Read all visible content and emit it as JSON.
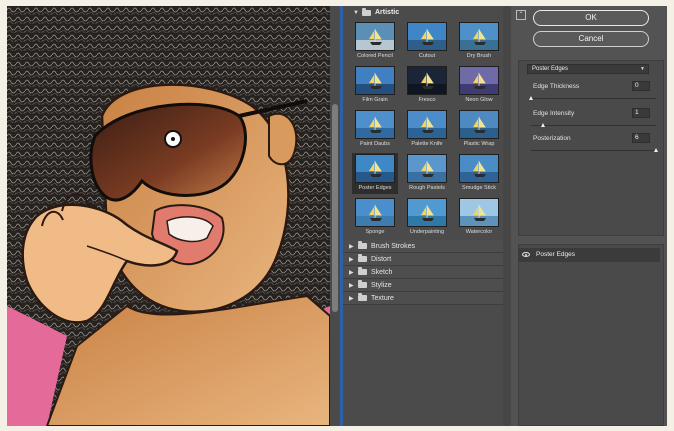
{
  "gallery": {
    "open_folder": "Artistic",
    "thumbnails": [
      {
        "label": "Colored Pencil",
        "sky": "#5b8fb6",
        "sea": "#b6c7cf"
      },
      {
        "label": "Cutout",
        "sky": "#3f86c9",
        "sea": "#2e5f8a"
      },
      {
        "label": "Dry Brush",
        "sky": "#4e90c8",
        "sea": "#3a6f96"
      },
      {
        "label": "Film Grain",
        "sky": "#3f7fc2",
        "sea": "#244f7f"
      },
      {
        "label": "Fresco",
        "sky": "#1c2538",
        "sea": "#0f1522"
      },
      {
        "label": "Neon Glow",
        "sky": "#6f6aa8",
        "sea": "#3e3c72"
      },
      {
        "label": "Paint Daubs",
        "sky": "#4f8fcb",
        "sea": "#2f6aa0"
      },
      {
        "label": "Palette Knife",
        "sky": "#4c8cc8",
        "sea": "#2c6397"
      },
      {
        "label": "Plastic Wrap",
        "sky": "#4e89bf",
        "sea": "#2b5f8e"
      },
      {
        "label": "Poster Edges",
        "sky": "#3e88c6",
        "sea": "#26598a"
      },
      {
        "label": "Rough Pastels",
        "sky": "#5b97cc",
        "sea": "#3a70a0"
      },
      {
        "label": "Smudge Stick",
        "sky": "#4a8dc6",
        "sea": "#2d6396"
      },
      {
        "label": "Sponge",
        "sky": "#4a8fcb",
        "sea": "#3e7cb0"
      },
      {
        "label": "Underpainting",
        "sky": "#4f9ad0",
        "sea": "#2f79a8"
      },
      {
        "label": "Watercolor",
        "sky": "#9ec7e6",
        "sea": "#5d92bb"
      }
    ],
    "folders": [
      "Brush Strokes",
      "Distort",
      "Sketch",
      "Stylize",
      "Texture"
    ]
  },
  "buttons": {
    "ok": "OK",
    "cancel": "Cancel"
  },
  "filter_select": "Poster Edges",
  "params": [
    {
      "label": "Edge Thickness",
      "value": "0",
      "fraction": 0.0
    },
    {
      "label": "Edge Intensity",
      "value": "1",
      "fraction": 0.1
    },
    {
      "label": "Posterization",
      "value": "6",
      "fraction": 1.0
    }
  ],
  "layer": {
    "name": "Poster Edges"
  },
  "colors": {
    "accent": "#2f5fa8",
    "panel": "#535353",
    "skin": "#d9975b",
    "pink": "#e46a9a"
  }
}
